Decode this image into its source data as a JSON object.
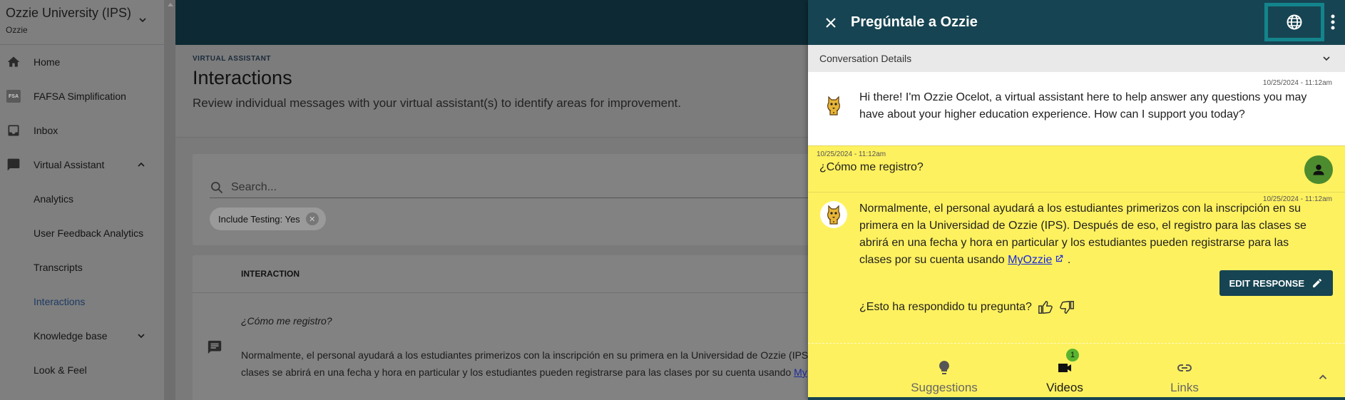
{
  "sidebar": {
    "org_name": "Ozzie University (IPS)",
    "org_sub": "Ozzie",
    "items": [
      {
        "label": "Home",
        "icon": "home-icon"
      },
      {
        "label": "FAFSA Simplification",
        "icon": "fsa-icon",
        "icon_text": "FSA"
      },
      {
        "label": "Inbox",
        "icon": "inbox-icon"
      },
      {
        "label": "Virtual Assistant",
        "icon": "chat-icon"
      },
      {
        "label": "Analytics"
      },
      {
        "label": "User Feedback Analytics"
      },
      {
        "label": "Transcripts"
      },
      {
        "label": "Interactions"
      },
      {
        "label": "Knowledge base"
      },
      {
        "label": "Look & Feel"
      }
    ]
  },
  "main": {
    "eyebrow": "VIRTUAL ASSISTANT",
    "title": "Interactions",
    "description": "Review individual messages with your virtual assistant(s) to identify areas for improvement.",
    "search_placeholder": "Search...",
    "filter_chip": "Include Testing: Yes",
    "table": {
      "header": "INTERACTION",
      "question": "¿Cómo me registro?",
      "answer_line1": "Normalmente, el personal ayudará a los estudiantes primerizos con la inscripción en su primera en la Universidad de Ozzie (IPS).",
      "answer_line2": "clases se abrirá en una fecha y hora en particular y los estudiantes pueden registrarse para las clases por su cuenta usando",
      "answer_link": "My"
    }
  },
  "panel": {
    "title": "Pregúntale a Ozzie",
    "conversation_details": "Conversation Details",
    "messages": {
      "bot1": {
        "timestamp": "10/25/2024 - 11:12am",
        "text_line1": "Hi there! I'm Ozzie Ocelot, a virtual assistant here to help answer any questions you may",
        "text_line2": "have about your higher education experience. How can I support you today?"
      },
      "user": {
        "timestamp": "10/25/2024 - 11:12am",
        "text": "¿Cómo me registro?"
      },
      "bot2": {
        "timestamp": "10/25/2024 - 11:12am",
        "line1": "Normalmente, el personal ayudará a los estudiantes primerizos con la inscripción en su",
        "line2": "primera en la Universidad de Ozzie (IPS). Después de eso, el registro para las clases se",
        "line3": "abrirá en una fecha y hora en particular y los estudiantes pueden registrarse para las",
        "line4_prefix": "clases por su cuenta usando ",
        "link_text": "MyOzzie",
        "line4_suffix": " ."
      }
    },
    "edit_response": "EDIT RESPONSE",
    "helpful_question": "¿Esto ha respondido tu pregunta?",
    "tabs": [
      {
        "label": "Suggestions",
        "icon": "lightbulb-icon"
      },
      {
        "label": "Videos",
        "icon": "video-icon",
        "badge": "1"
      },
      {
        "label": "Links",
        "icon": "link-icon"
      }
    ]
  },
  "colors": {
    "panel_header": "#174452",
    "topbar": "#0d2a34",
    "highlight": "#fef15f",
    "accent_teal": "#13848c",
    "user_avatar": "#4c8b2e",
    "badge": "#58b430"
  }
}
